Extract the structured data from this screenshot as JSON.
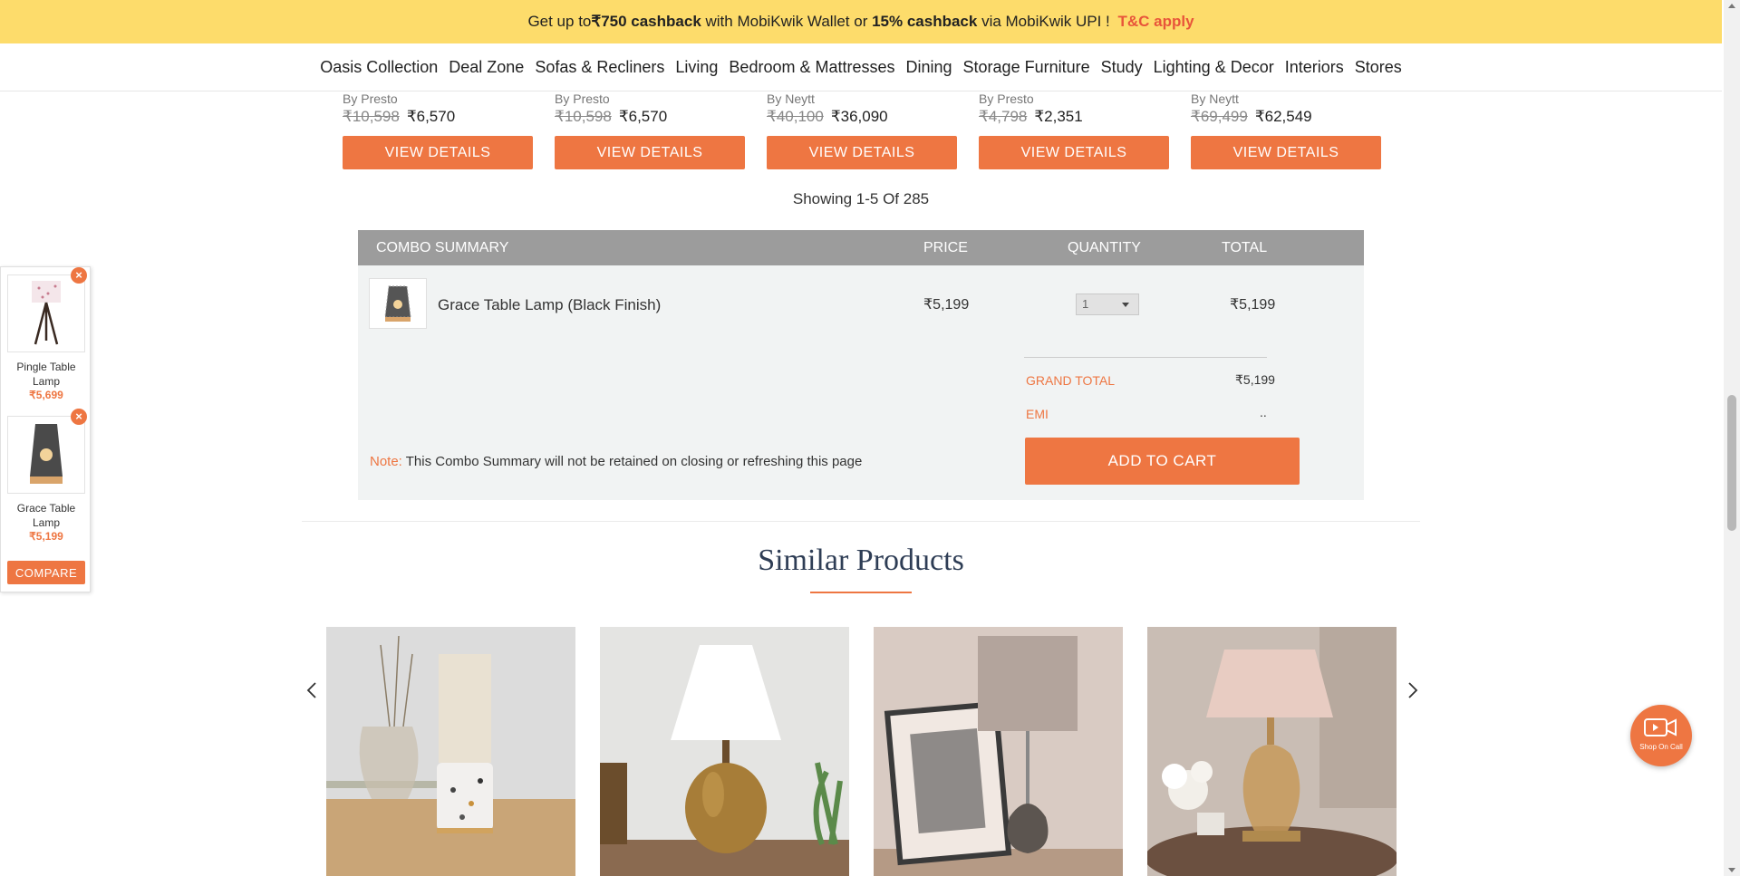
{
  "promo": {
    "prefix": "Get up to ",
    "cashback1": "₹750 cashback",
    "mid": " with MobiKwik Wallet or ",
    "cashback2": "15% cashback",
    "suffix": " via MobiKwik UPI ! ",
    "tc": "T&C apply"
  },
  "nav": {
    "items": [
      "Oasis Collection",
      "Deal Zone",
      "Sofas & Recliners",
      "Living",
      "Bedroom & Mattresses",
      "Dining",
      "Storage Furniture",
      "Study",
      "Lighting & Decor",
      "Interiors",
      "Stores"
    ]
  },
  "products": [
    {
      "brand": "By Presto",
      "old_price": "₹10,598",
      "price": "₹6,570",
      "button": "VIEW DETAILS"
    },
    {
      "brand": "By Presto",
      "old_price": "₹10,598",
      "price": "₹6,570",
      "button": "VIEW DETAILS"
    },
    {
      "brand": "By Neytt",
      "old_price": "₹40,100",
      "price": "₹36,090",
      "button": "VIEW DETAILS"
    },
    {
      "brand": "By Presto",
      "old_price": "₹4,798",
      "price": "₹2,351",
      "button": "VIEW DETAILS"
    },
    {
      "brand": "By Neytt",
      "old_price": "₹69,499",
      "price": "₹62,549",
      "button": "VIEW DETAILS"
    }
  ],
  "showing": "Showing 1-5 Of 285",
  "combo": {
    "headers": {
      "summary": "COMBO SUMMARY",
      "price": "PRICE",
      "quantity": "QUANTITY",
      "total": "TOTAL"
    },
    "item": {
      "name": "Grace Table Lamp (Black Finish)",
      "price": "₹5,199",
      "quantity": "1",
      "total": "₹5,199"
    },
    "grand_total_label": "GRAND TOTAL",
    "grand_total_value": "₹5,199",
    "emi_label": "EMI",
    "emi_value": "..",
    "note_label": "Note: ",
    "note_text": "This Combo Summary will not be retained on closing or refreshing this page",
    "add_to_cart": "ADD TO CART"
  },
  "similar": {
    "title": "Similar Products"
  },
  "compare": {
    "items": [
      {
        "name": "Pingle Table Lamp",
        "price": "₹5,699"
      },
      {
        "name": "Grace Table Lamp",
        "price": "₹5,199"
      }
    ],
    "button": "COMPARE"
  },
  "shop_on_call": {
    "label": "Shop On Call"
  },
  "colors": {
    "accent": "#ee7642",
    "promo_bg": "#fddc6b",
    "combo_header": "#9c9c9c",
    "title": "#2e3d55"
  }
}
